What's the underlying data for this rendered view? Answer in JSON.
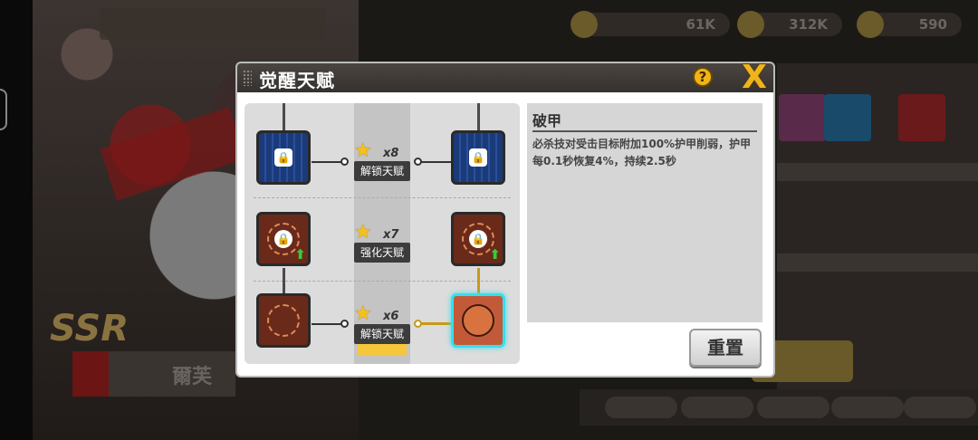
{
  "background": {
    "resources": [
      {
        "icon": "coin-icon",
        "value": "61K"
      },
      {
        "icon": "crystal-icon",
        "value": "312K"
      },
      {
        "icon": "gem-icon",
        "value": "590"
      }
    ],
    "rarity": "SSR",
    "character_name": "爾芙"
  },
  "modal": {
    "title": "觉醒天赋",
    "help_label": "?",
    "close_label": "X",
    "tree": {
      "rows": [
        {
          "stars": "x8",
          "action": "解锁天赋"
        },
        {
          "stars": "x7",
          "action": "强化天赋"
        },
        {
          "stars": "x6",
          "action": "解锁天赋"
        }
      ],
      "star_glyph": "★",
      "lock_glyph": "🔒",
      "upgrade_glyph": "⬆"
    },
    "detail": {
      "name": "破甲",
      "description": "必杀技对受击目标附加100%护甲削弱，护甲每0.1秒恢复4%，持续2.5秒"
    },
    "reset_label": "重置"
  },
  "colors": {
    "accent_gold": "#f0b41a",
    "active_glow": "#33e0f0",
    "header_dark": "#3e3a37"
  }
}
